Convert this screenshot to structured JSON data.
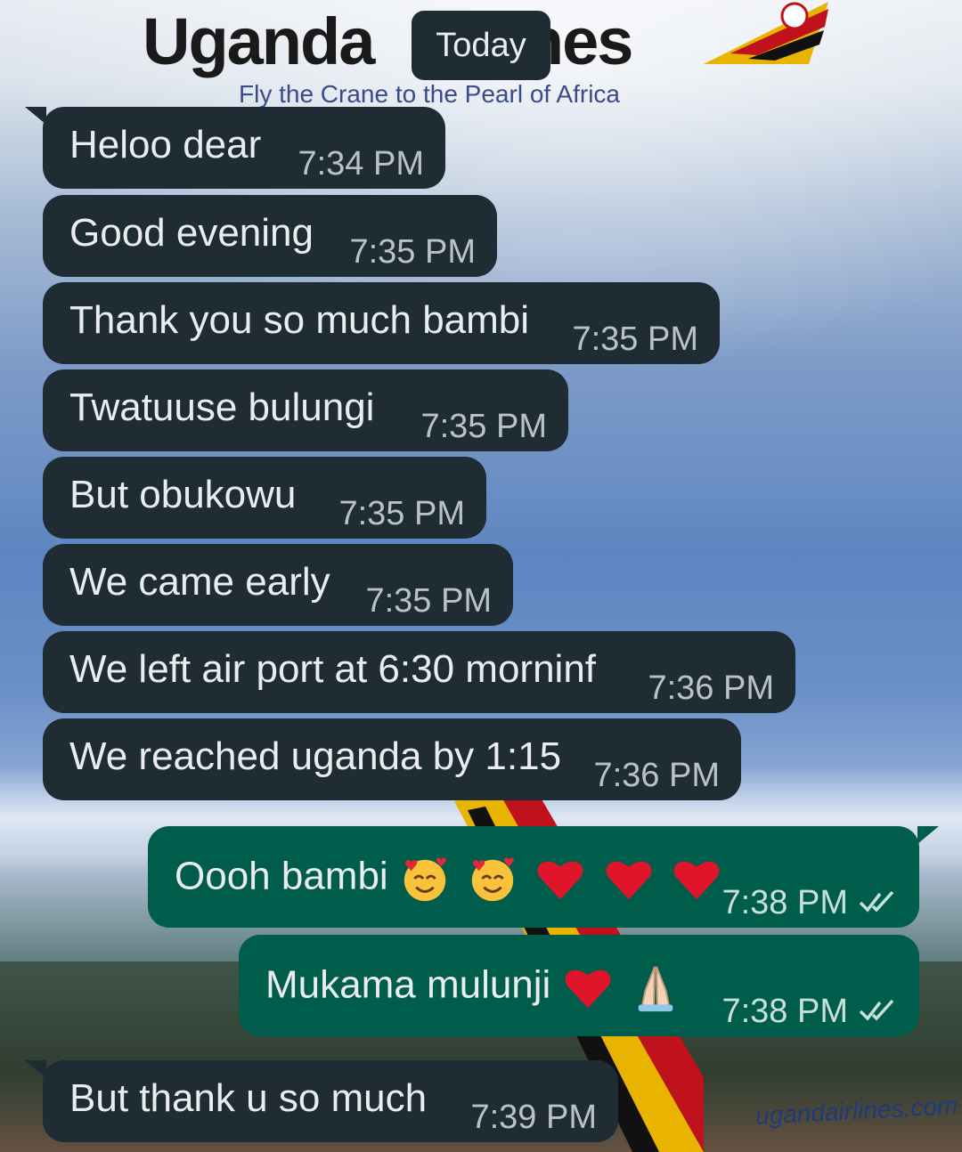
{
  "background": {
    "brand_title": "Uganda Airlines",
    "brand_title_visible": "Uganda",
    "brand_title_suffix": "ines",
    "brand_tagline": "Fly the Crane to the Pearl of Africa",
    "brand_website": "ugandairlines.com"
  },
  "date_divider": {
    "label": "Today"
  },
  "messages": [
    {
      "direction": "in",
      "text": "Heloo dear",
      "time": "7:34 PM"
    },
    {
      "direction": "in",
      "text": "Good evening",
      "time": "7:35 PM"
    },
    {
      "direction": "in",
      "text": "Thank you so much bambi",
      "time": "7:35 PM"
    },
    {
      "direction": "in",
      "text": "Twatuuse bulungi",
      "time": "7:35 PM"
    },
    {
      "direction": "in",
      "text": "But obukowu",
      "time": "7:35 PM"
    },
    {
      "direction": "in",
      "text": "We came early",
      "time": "7:35 PM"
    },
    {
      "direction": "in",
      "text": "We left air port at 6:30 morninf",
      "time": "7:36 PM"
    },
    {
      "direction": "in",
      "text": "We reached uganda by 1:15",
      "time": "7:36 PM"
    },
    {
      "direction": "out",
      "text": "Oooh bambi",
      "emojis": [
        "smiling-face-with-hearts",
        "smiling-face-with-hearts",
        "red-heart",
        "red-heart",
        "red-heart"
      ],
      "time": "7:38 PM",
      "status": "read"
    },
    {
      "direction": "out",
      "text": "Mukama  mulunji",
      "emojis": [
        "red-heart",
        "folded-hands"
      ],
      "time": "7:38 PM",
      "status": "read"
    },
    {
      "direction": "in",
      "text": "But thank u so much",
      "time": "7:39 PM"
    }
  ],
  "colors": {
    "incoming_bubble": "#202c33",
    "outgoing_bubble": "#005c4b",
    "text": "#e9edef",
    "timestamp": "#b8c2c8"
  }
}
